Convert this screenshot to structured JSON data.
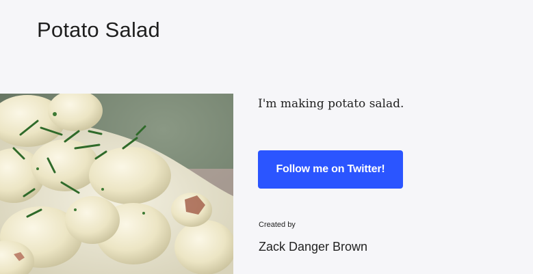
{
  "page": {
    "title": "Potato Salad",
    "description": "I'm making potato salad."
  },
  "hero": {
    "image_label": "potato salad"
  },
  "cta": {
    "label": "Follow me on Twitter!",
    "color": "#2b55ff"
  },
  "credits": {
    "label": "Created by",
    "author": "Zack Danger Brown"
  }
}
